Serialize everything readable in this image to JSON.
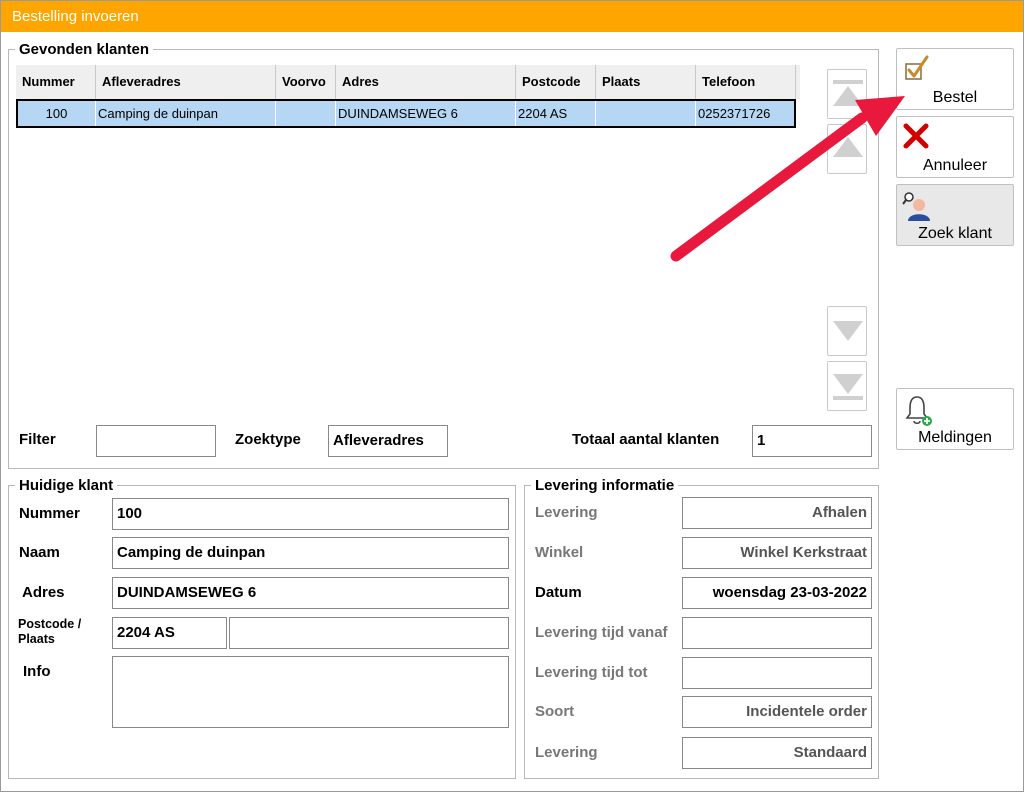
{
  "window": {
    "title": "Bestelling invoeren"
  },
  "found_customers": {
    "legend": "Gevonden klanten",
    "columns": [
      "Nummer",
      "Afleveradres",
      "Voorvo",
      "Adres",
      "Postcode",
      "Plaats",
      "Telefoon"
    ],
    "rows": [
      {
        "nummer": "100",
        "afleveradres": "Camping de duinpan",
        "voorvo": "",
        "adres": "DUINDAMSEWEG 6",
        "postcode": "2204 AS",
        "plaats": "",
        "telefoon": "0252371726"
      }
    ],
    "filter_label": "Filter",
    "filter_value": "",
    "zoektype_label": "Zoektype",
    "zoektype_value": "Afleveradres",
    "total_label": "Totaal aantal klanten",
    "total_value": "1"
  },
  "current_customer": {
    "legend": "Huidige klant",
    "nummer_label": "Nummer",
    "nummer_value": "100",
    "naam_label": "Naam",
    "naam_value": "Camping de duinpan",
    "adres_label": "Adres",
    "adres_value": "DUINDAMSEWEG 6",
    "postcode_label": "Postcode /",
    "plaats_label": "Plaats",
    "postcode_value": "2204 AS",
    "plaats_value": "",
    "info_label": "Info",
    "info_value": ""
  },
  "delivery": {
    "legend": "Levering informatie",
    "levering_label": "Levering",
    "levering_value": "Afhalen",
    "winkel_label": "Winkel",
    "winkel_value": "Winkel Kerkstraat",
    "datum_label": "Datum",
    "datum_value": "woensdag 23-03-2022",
    "tijd_vanaf_label": "Levering tijd vanaf",
    "tijd_vanaf_value": "",
    "tijd_tot_label": "Levering tijd tot",
    "tijd_tot_value": "",
    "soort_label": "Soort",
    "soort_value": "Incidentele order",
    "levering2_label": "Levering",
    "levering2_value": "Standaard"
  },
  "actions": {
    "bestel": "Bestel",
    "annuleer": "Annuleer",
    "zoek_klant": "Zoek klant",
    "meldingen": "Meldingen"
  },
  "icons": {
    "bestel": "checkbox-check-icon",
    "annuleer": "red-x-icon",
    "zoek_klant": "user-search-icon",
    "meldingen": "bell-add-icon",
    "nav_first": "first-record-icon",
    "nav_prev": "previous-record-icon",
    "nav_next": "next-record-icon",
    "nav_last": "last-record-icon",
    "annotation": "red-arrow-annotation"
  },
  "colors": {
    "titlebar": "#ffa500",
    "selected_row": "#b6d7f3",
    "arrow": "#e8193c"
  }
}
